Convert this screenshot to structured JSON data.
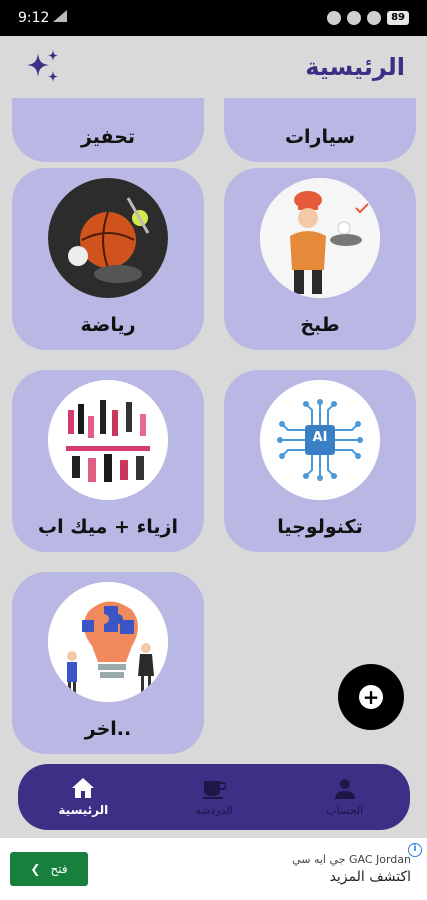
{
  "status": {
    "time": "9:12",
    "battery": "89"
  },
  "appbar": {
    "title": "الرئيسية"
  },
  "categories": [
    {
      "label": "تحفيز"
    },
    {
      "label": "سيارات"
    },
    {
      "label": "رياضة"
    },
    {
      "label": "طبخ"
    },
    {
      "label": "ازياء + ميك اب"
    },
    {
      "label": "تكنولوجيا"
    },
    {
      "label": "اخر.."
    }
  ],
  "tech_badge": "AI",
  "bottom_nav": [
    {
      "label": "الرئيسية",
      "icon": "home-icon"
    },
    {
      "label": "الدردشة",
      "icon": "chat-cup-icon"
    },
    {
      "label": "الحساب",
      "icon": "person-icon"
    }
  ],
  "ad": {
    "sponsor": "جي ايه سي GAC Jordan",
    "cta": "اكتشف المزيد",
    "button": "فتح"
  },
  "colors": {
    "primary": "#3b2f86",
    "card": "#b9b7e3",
    "background": "#d9d9d9"
  }
}
